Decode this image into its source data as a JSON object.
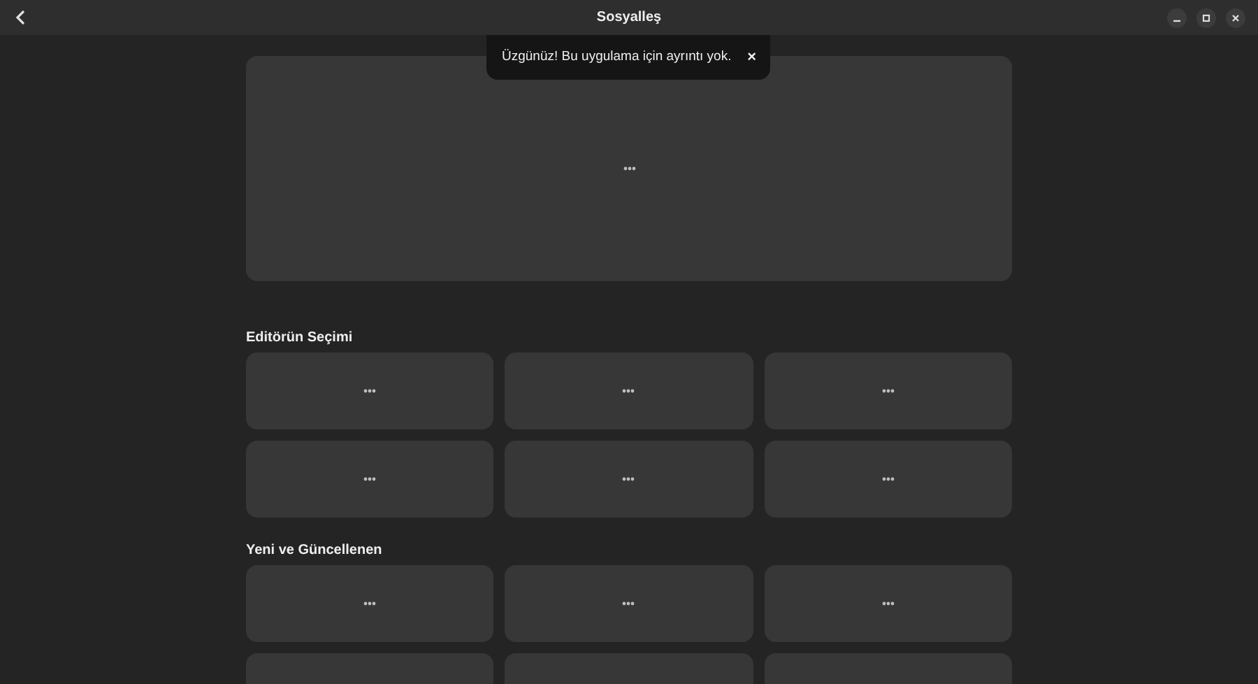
{
  "window": {
    "title": "Sosyalleş"
  },
  "toast": {
    "message": "Üzgünüz! Bu uygulama için ayrıntı yok.",
    "close": "×"
  },
  "banner": {
    "loading": true
  },
  "sections": [
    {
      "title": "Editörün Seçimi",
      "cards": [
        {
          "loading": true
        },
        {
          "loading": true
        },
        {
          "loading": true
        },
        {
          "loading": true
        },
        {
          "loading": true
        },
        {
          "loading": true
        }
      ]
    },
    {
      "title": "Yeni ve Güncellenen",
      "cards": [
        {
          "loading": true
        },
        {
          "loading": true
        },
        {
          "loading": true
        }
      ],
      "more_rows_below": true
    }
  ]
}
